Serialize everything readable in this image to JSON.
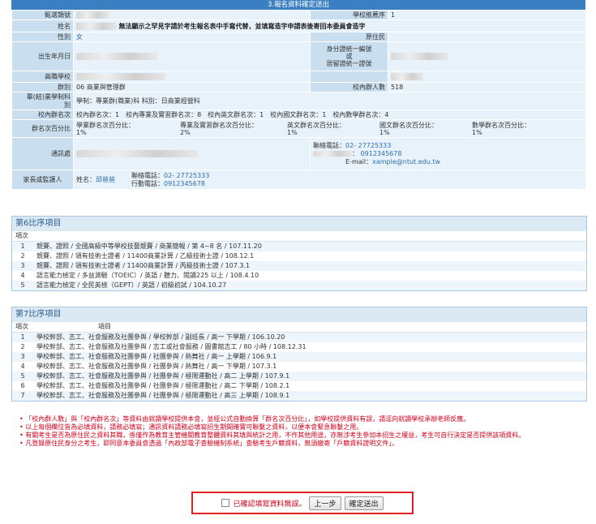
{
  "header": {
    "title": "3.報名資料確定送出"
  },
  "info": {
    "dept_label": "甄選類號",
    "school_rank_label": "學校推薦序",
    "school_rank_value": "1",
    "name_label": "姓名",
    "name_note_1": "無法顯示之罕見字請於考生報名表中手寫代替，並填寫",
    "name_note_link": "造字申請表",
    "name_note_2": "後寄回本委員會造字",
    "gender_label": "性別",
    "gender_value": "女",
    "ethnic_label": "原住民",
    "dob_label": "出生年月日",
    "id_label_1": "身分證統一編號",
    "id_label_2": "或",
    "id_label_3": "居留證統一證號",
    "school_label": "高職學校",
    "group_label": "群別",
    "group_value": "06 商業與管理群",
    "school_count_label": "校內群人數",
    "school_count_value": "518",
    "program_label_1": "畢(結)業學制科",
    "program_label_2": "別",
    "program_value": "學制：專業群(職業)科 科別：日商業經營科",
    "rank_label": "校內群名次",
    "rank_value": "校內群名次：1　校內專業及實習群名次：8　校內英文群名次：1　校內國文群名次：1　校內數學群名次：4",
    "pct_label": "群名次百分比",
    "pct_items": [
      {
        "label": "學業群名次百分比：",
        "value": "1%"
      },
      {
        "label": "專業及實習群名次百分比：",
        "value": "2%"
      },
      {
        "label": "英文群名次百分比：",
        "value": "1%"
      },
      {
        "label": "國文群名次百分比：",
        "value": "1%"
      },
      {
        "label": "數學群名次百分比：",
        "value": "1%"
      }
    ],
    "address_label": "通訊處",
    "contact_phone_label": "聯絡電話：",
    "contact_phone_value": "02- 27725333",
    "mobile_value": "0912345678",
    "email_label": "E-mail：",
    "email_value": "xample@ntut.edu.tw",
    "guardian_label": "家長或監護人",
    "guardian_name_label": "姓名：",
    "guardian_name_value": "邱爸爸",
    "guardian_phone_label": "聯絡電話：",
    "guardian_phone_value": "02- 27725333",
    "guardian_mobile_label": "行動電話：",
    "guardian_mobile_value": "0912345678"
  },
  "section6": {
    "title": "第6比序項目",
    "col_no": "項次",
    "rows": [
      {
        "no": "1",
        "text": "競賽、證照 / 全國高級中等學校技藝競賽 / 商業簡報 / 第 4~8 名 / 107.11.20"
      },
      {
        "no": "2",
        "text": "競賽、證照 / 領有技術士證者 / 11400商業計算 / 乙級技術士證 / 108.12.1"
      },
      {
        "no": "3",
        "text": "競賽、證照 / 領有技術士證者 / 11400商業計算 / 丙級技術士證 / 107.3.1"
      },
      {
        "no": "4",
        "text": "語言能力檢定 / 多益測驗（TOEIC）/ 英語 / 聽力、閱讀225 以上 / 108.4.10"
      },
      {
        "no": "5",
        "text": "語言能力檢定 / 全民英檢（GEPT）/ 英語 / 初級初試 / 104.10.27"
      }
    ]
  },
  "section7": {
    "title": "第7比序項目",
    "col_no": "項次",
    "col_item": "項目",
    "rows": [
      {
        "no": "1",
        "text": "學校幹部、志工、社會服務及社團參與 / 學校幹部 / 副班長 / 高一 下學期 / 106.10.20"
      },
      {
        "no": "2",
        "text": "學校幹部、志工、社會服務及社團參與 / 志工或社會服務 / 圖書館志工 / 80 小時 / 108.12.31"
      },
      {
        "no": "3",
        "text": "學校幹部、志工、社會服務及社團參與 / 社團參與 / 熱舞社 / 高一 上學期 / 106.9.1"
      },
      {
        "no": "4",
        "text": "學校幹部、志工、社會服務及社團參與 / 社團參與 / 熱舞社 / 高一 下學期 / 107.3.1"
      },
      {
        "no": "5",
        "text": "學校幹部、志工、社會服務及社團參與 / 社團參與 / 極限運動社 / 高二 上學期 / 107.9.1"
      },
      {
        "no": "6",
        "text": "學校幹部、志工、社會服務及社團參與 / 社團參與 / 極限運動社 / 高二 下學期 / 108.2.1"
      },
      {
        "no": "7",
        "text": "學校幹部、志工、社會服務及社團參與 / 社團參與 / 極限運動社 / 高三 上學期 / 108.9.1"
      }
    ]
  },
  "notes": [
    "「校內群人數」與「校內群名次」等資料由就讀學校提供本會，並經公式自動換算「群名次百分比」，如學校提供資料有誤，請逕向就讀學校承辦老師反應。",
    "以上每個欄位皆為必填資料，請務必填寫；通訊資料請務必填寫招生期間確實可聯繫之資料，以便本會緊急聯繫之用。",
    "有關考生是否為原住民之資料其職，係僅作為教育主管機關教育整體資料其填與統計之用，不作其他用途，亦無涉考生參加本招生之權益，考生可自行決定是否提供該項資料。",
    "凡登錄原住民身分之考生，即同意本委員會透過「內政部電子查驗機制系統」查驗考生戶籍資料，無須繳寄「戶籍資料證明文件」。"
  ],
  "confirm": {
    "checkbox_label": "已確認填寫資料無誤。",
    "prev_button": "上一步",
    "submit_button": "確定送出"
  }
}
